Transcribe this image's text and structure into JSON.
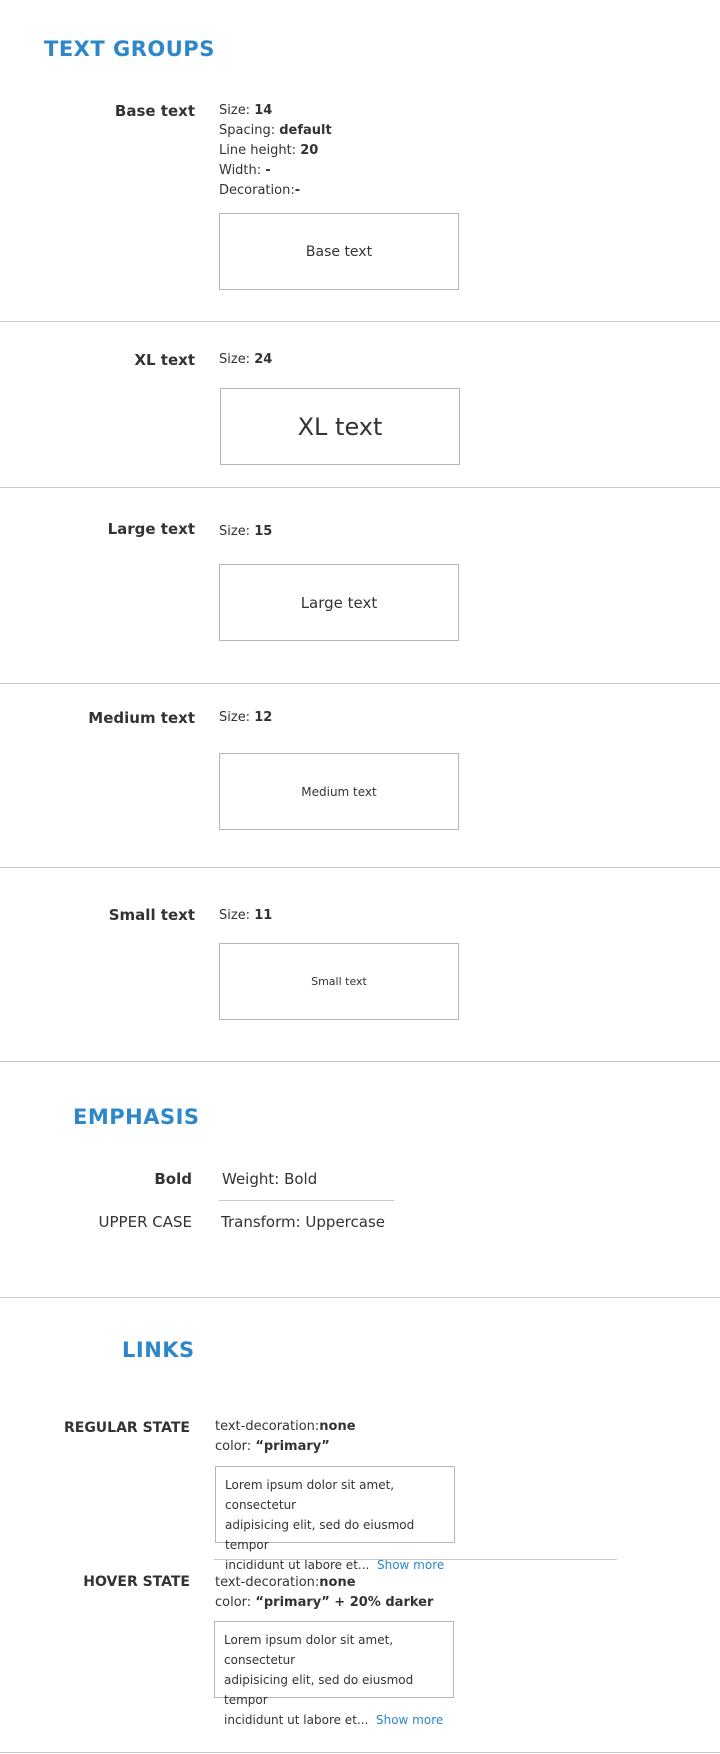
{
  "text_groups": {
    "title": "TEXT GROUPS",
    "base": {
      "label": "Base text",
      "size_label": "Size:",
      "size_value": "14",
      "spacing_label": "Spacing:",
      "spacing_value": "default",
      "line_height_label": "Line height:",
      "line_height_value": "20",
      "width_label": "Width:",
      "width_value": "-",
      "decoration_label": "Decoration:",
      "decoration_value": "-",
      "sample": "Base text"
    },
    "xl": {
      "label": "XL text",
      "size_label": "Size:",
      "size_value": "24",
      "sample": "XL text"
    },
    "large": {
      "label": "Large text",
      "size_label": "Size:",
      "size_value": "15",
      "sample": "Large text"
    },
    "medium": {
      "label": "Medium text",
      "size_label": "Size:",
      "size_value": "12",
      "sample": "Medium text"
    },
    "small": {
      "label": "Small text",
      "size_label": "Size:",
      "size_value": "11",
      "sample": "Small text"
    }
  },
  "emphasis": {
    "title": "EMPHASIS",
    "bold_label": "Bold",
    "bold_desc": "Weight: Bold",
    "upper_label": "UPPER CASE",
    "upper_desc": "Transform: Uppercase"
  },
  "links": {
    "title": "LINKS",
    "regular": {
      "label": "REGULAR STATE",
      "decoration_label": "text-decoration:",
      "decoration_value": "none",
      "color_label": "color:",
      "color_value": "“primary”",
      "lorem_line1": "Lorem ipsum dolor sit amet, consectetur",
      "lorem_line2": "adipisicing elit, sed do eiusmod tempor",
      "lorem_line3": "incididunt ut labore et...",
      "link_text": "Show more"
    },
    "hover": {
      "label": "HOVER STATE",
      "decoration_label": "text-decoration:",
      "decoration_value": "none",
      "color_label": "color:",
      "color_value": "“primary” + 20% darker",
      "lorem_line1": "Lorem ipsum dolor sit amet, consectetur",
      "lorem_line2": "adipisicing elit, sed do eiusmod tempor",
      "lorem_line3": "incididunt ut labore et...",
      "link_text": "Show more"
    }
  },
  "colors": {
    "primary": "#2d87c9",
    "primary_hover": "#246ca1",
    "text": "#333333",
    "border": "#b5b5b5"
  }
}
